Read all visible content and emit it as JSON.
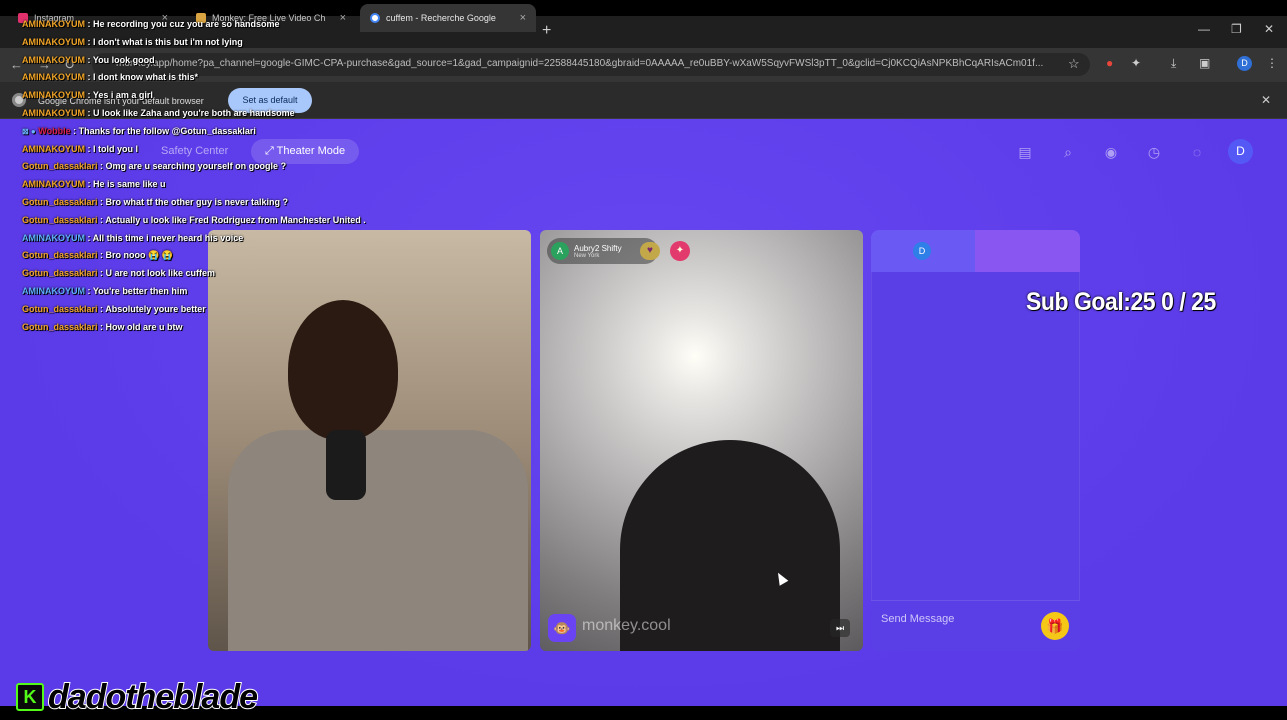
{
  "browser": {
    "tabs": [
      {
        "label": "Instagram",
        "close": "×"
      },
      {
        "label": "Monkey: Free Live Video Ch",
        "close": "×"
      },
      {
        "label": "cuffem - Recherche Google",
        "close": "×"
      }
    ],
    "new_tab": "+",
    "url": "monkey.app/home?pa_channel=google-GIMC-CPA-purchase&gad_source=1&gad_campaignid=22588445180&gbraid=0AAAAA_re0uBBY-wXaW5SqyvFWSl3pTT_0&gclid=Cj0KCQiAsNPKBhCqARIsACm01f...",
    "profile_initial": "D",
    "infobar": {
      "message": "Google Chrome isn't your default browser",
      "button": "Set as default"
    }
  },
  "app": {
    "nav": {
      "safety_center": "Safety Center",
      "theater_mode": "Theater Mode",
      "profile_initial": "D"
    },
    "peer": {
      "initial": "A",
      "name": "Aubry2 Shifty",
      "location": "New York"
    },
    "watermark": "monkey.cool",
    "chat_panel": {
      "tab_left_initial": "D",
      "tab_right_initial": "A",
      "send_placeholder": "Send Message"
    }
  },
  "overlay": {
    "sub_goal": "Sub Goal:25  0 / 25",
    "streamer": "dadotheblade",
    "kick_glyph": "K",
    "chat": [
      {
        "user": "AMINAKOYUM",
        "text": " : He recording you cuz you are so handsome",
        "color": "orange"
      },
      {
        "user": "AMINAKOYUM",
        "text": " : I don't what is this but i'm not lying",
        "color": "orange"
      },
      {
        "user": "AMINAKOYUM",
        "text": " : You look good",
        "color": "orange"
      },
      {
        "user": "AMINAKOYUM",
        "text": " : I dont know what is this*",
        "color": "orange"
      },
      {
        "user": "AMINAKOYUM",
        "text": " : Yes i am a girl",
        "color": "orange"
      },
      {
        "user": "AMINAKOYUM",
        "text": " : U look like Zaha and you're both are handsome",
        "color": "orange"
      },
      {
        "user": "Wobble",
        "text": " : Thanks for the follow @Gotun_dassaklari",
        "color": "red",
        "badges": "⊠ ●"
      },
      {
        "user": "AMINAKOYUM",
        "text": " : I told you l",
        "color": "orange"
      },
      {
        "user": "Gotun_dassaklari",
        "text": " : Omg are u searching yourself on google ?",
        "color": "orange"
      },
      {
        "user": "AMINAKOYUM",
        "text": " : He is same like u",
        "color": "orange"
      },
      {
        "user": "Gotun_dassaklari",
        "text": " : Bro what tf the other guy is never talking ?",
        "color": "orange"
      },
      {
        "user": "Gotun_dassaklari",
        "text": " : Actually u look like Fred Rodriguez from Manchester United .",
        "color": "orange"
      },
      {
        "user": "AMINAKOYUM",
        "text": " : All this time i never heard his voice",
        "color": "blue"
      },
      {
        "user": "Gotun_dassaklari",
        "text": " : Bro nooo 😭 😭",
        "color": "orange"
      },
      {
        "user": "Gotun_dassaklari",
        "text": " : U are not look like cuffem",
        "color": "orange"
      },
      {
        "user": "AMINAKOYUM",
        "text": " : You're better then him",
        "color": "blue"
      },
      {
        "user": "Gotun_dassaklari",
        "text": " : Absolutely youre better",
        "color": "orange"
      },
      {
        "user": "Gotun_dassaklari",
        "text": " : How old are u btw",
        "color": "orange"
      }
    ]
  }
}
